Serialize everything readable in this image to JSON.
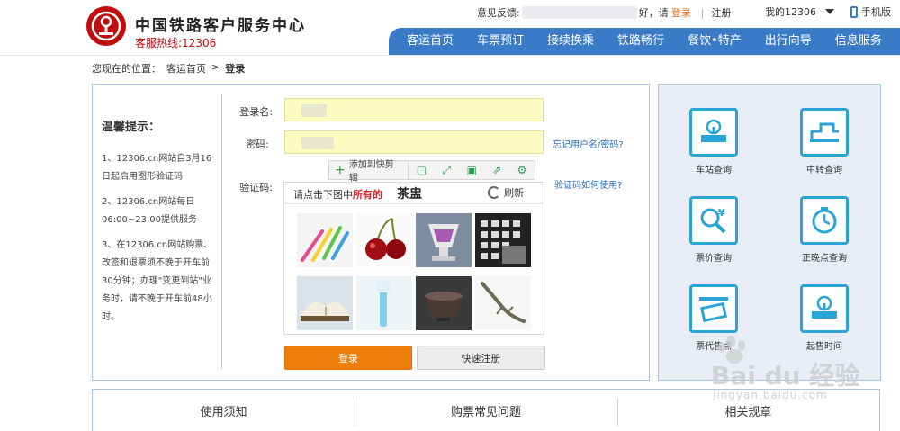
{
  "header": {
    "title": "中国铁路客户服务中心",
    "hotline": "客服热线:12306",
    "feedback_label": "意见反馈:",
    "greeting_suffix": "好，请",
    "login_link": "登录",
    "separator": "|",
    "register_link": "注册",
    "my12306": "我的12306",
    "mobile": "手机版"
  },
  "nav": {
    "items": [
      "客运首页",
      "车票预订",
      "接续换乘",
      "铁路畅行",
      "餐饮•特产",
      "出行向导",
      "信息服务"
    ]
  },
  "breadcrumb": {
    "prefix": "您现在的位置：",
    "home": "客运首页",
    "arrow": ">",
    "current": "登录"
  },
  "tips": {
    "title": "温馨提示：",
    "items": [
      "1、12306.cn网站自3月16日起启用图形验证码",
      "2、12306.cn网站每日06:00~23:00提供服务",
      "3、在12306.cn网站购票、改签和退票须不晚于开车前30分钟；办理\"变更到站\"业务时，请不晚于开车前48小时。"
    ]
  },
  "form": {
    "username_label": "登录名:",
    "password_label": "密码:",
    "captcha_label": "验证码:",
    "forgot_link": "忘记用户名/密码?",
    "captcha_help_link": "验证码如何使用?",
    "login_button": "登录",
    "register_button": "快速注册"
  },
  "clipboard": {
    "add_label": "添加到快剪辑",
    "icons": [
      "window-icon",
      "expand-icon",
      "save-icon",
      "share-icon",
      "settings-icon"
    ]
  },
  "captcha": {
    "prompt_prefix": "请点击下图中",
    "prompt_emphasis": "所有的",
    "target": "茶盅",
    "refresh": "刷新",
    "images": [
      "toothbrushes",
      "cherries",
      "ornate-cup",
      "calendar",
      "open-book",
      "toothbrush-blue",
      "dark-cup",
      "lizard"
    ]
  },
  "services": {
    "items": [
      {
        "label": "车站查询",
        "icon": "station-icon"
      },
      {
        "label": "中转查询",
        "icon": "transfer-icon"
      },
      {
        "label": "票价查询",
        "icon": "price-search-icon"
      },
      {
        "label": "正晚点查询",
        "icon": "clock-icon"
      },
      {
        "label": "票代售点",
        "icon": "ticket-agent-icon"
      },
      {
        "label": "起售时间",
        "icon": "sale-time-icon"
      }
    ]
  },
  "bottom_tabs": [
    "使用须知",
    "购票常见问题",
    "相关规章"
  ],
  "watermark": {
    "brand": "Bai du 经验",
    "url": "jingyan.baidu.com"
  },
  "colors": {
    "brand_red": "#c00d0d",
    "nav_blue": "#3a7bc8",
    "login_orange": "#f07e0b",
    "field_yellow": "#fbfbc2",
    "link_blue": "#2b6fc1",
    "service_teal": "#2aa3d6"
  }
}
